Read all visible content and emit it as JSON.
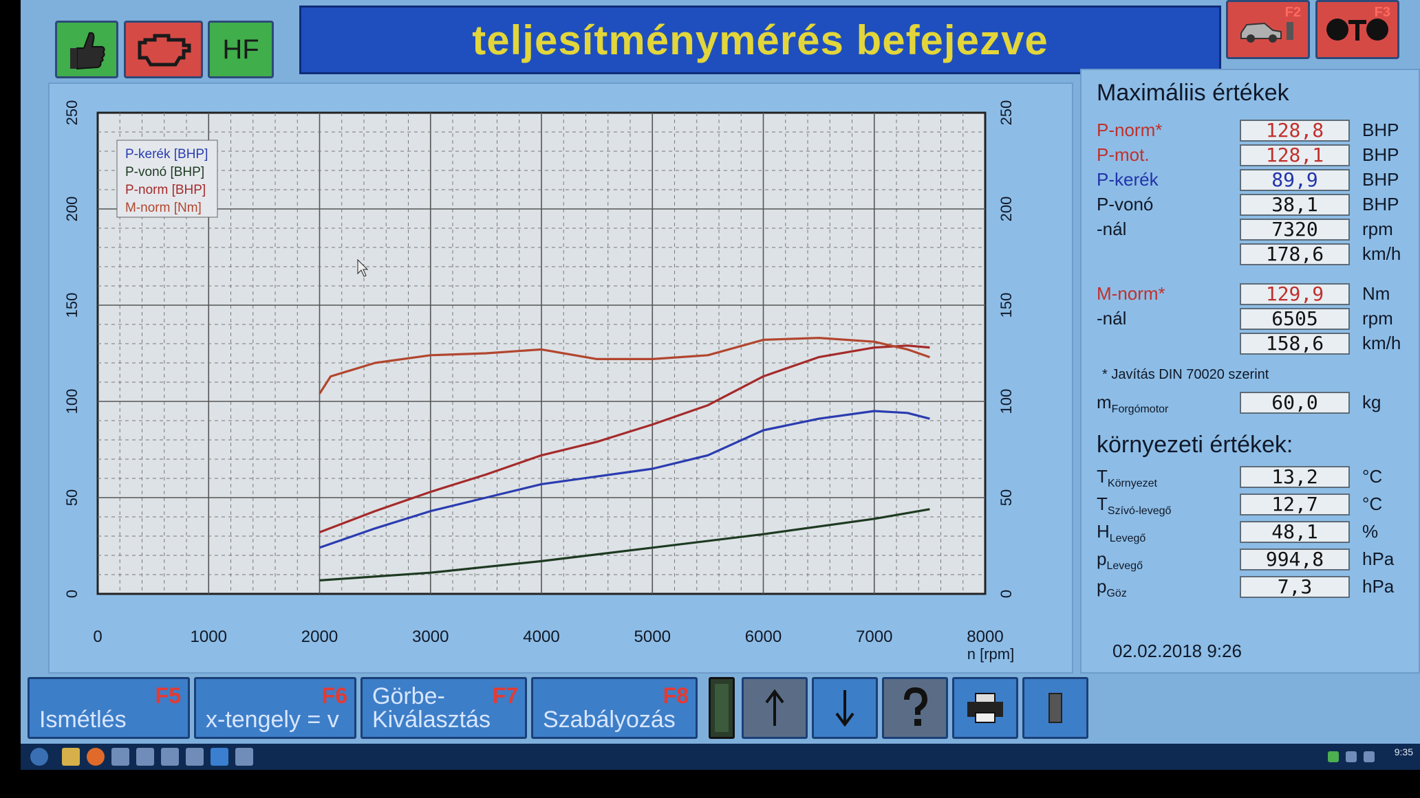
{
  "header": {
    "title": "teljesítménymérés befejezve",
    "hf_label": "HF",
    "f2_label": "F2",
    "f3_label": "F3"
  },
  "chart_data": {
    "type": "line",
    "xlabel": "n [rpm]",
    "xlim": [
      0,
      8000
    ],
    "ylim": [
      0,
      250
    ],
    "xticks": [
      0,
      1000,
      2000,
      3000,
      4000,
      5000,
      6000,
      7000,
      8000
    ],
    "yticks": [
      0,
      50,
      100,
      150,
      200,
      250
    ],
    "grid": true,
    "legend_position": "top-left",
    "series": [
      {
        "name": "P-kerék [BHP]",
        "color": "#2a3cb0",
        "x": [
          2000,
          2500,
          3000,
          3500,
          4000,
          4500,
          5000,
          5500,
          6000,
          6500,
          7000,
          7300,
          7500
        ],
        "y": [
          24,
          34,
          43,
          50,
          57,
          61,
          65,
          72,
          85,
          91,
          95,
          94,
          91
        ]
      },
      {
        "name": "P-vonó [BHP]",
        "color": "#1e3a22",
        "x": [
          2000,
          3000,
          4000,
          5000,
          6000,
          7000,
          7500
        ],
        "y": [
          7,
          11,
          17,
          24,
          31,
          39,
          44
        ]
      },
      {
        "name": "P-norm [BHP]",
        "color": "#a52a2a",
        "x": [
          2000,
          2500,
          3000,
          3500,
          4000,
          4500,
          5000,
          5500,
          6000,
          6500,
          7000,
          7300,
          7500
        ],
        "y": [
          32,
          43,
          53,
          62,
          72,
          79,
          88,
          98,
          113,
          123,
          128,
          129,
          128
        ]
      },
      {
        "name": "M-norm [Nm]",
        "color": "#b2462e",
        "x": [
          2000,
          2100,
          2500,
          3000,
          3500,
          4000,
          4500,
          5000,
          5500,
          6000,
          6500,
          7000,
          7300,
          7500
        ],
        "y": [
          104,
          113,
          120,
          124,
          125,
          127,
          122,
          122,
          124,
          132,
          133,
          131,
          127,
          123
        ]
      }
    ]
  },
  "max_values": {
    "title": "Maximáliis értékek",
    "rows": [
      {
        "label": "P-norm*",
        "value": "128,8",
        "unit": "BHP"
      },
      {
        "label": "P-mot.",
        "value": "128,1",
        "unit": "BHP"
      },
      {
        "label": "P-kerék",
        "value": "89,9",
        "unit": "BHP"
      },
      {
        "label": "P-vonó",
        "value": "38,1",
        "unit": "BHP"
      },
      {
        "label": "-nál",
        "value": "7320",
        "unit": "rpm"
      },
      {
        "label": "",
        "value": "178,6",
        "unit": "km/h"
      }
    ],
    "torque_rows": [
      {
        "label": "M-norm*",
        "value": "129,9",
        "unit": "Nm"
      },
      {
        "label": "-nál",
        "value": "6505",
        "unit": "rpm"
      },
      {
        "label": "",
        "value": "158,6",
        "unit": "km/h"
      }
    ],
    "note": "* Javítás DIN 70020 szerint",
    "mass": {
      "label": "m",
      "sub": "Forgómotor",
      "value": "60,0",
      "unit": "kg"
    }
  },
  "env": {
    "title": "környezeti értékek:",
    "rows": [
      {
        "label": "T",
        "sub": "Környezet",
        "value": "13,2",
        "unit": "°C"
      },
      {
        "label": "T",
        "sub": "Szívó-levegő",
        "value": "12,7",
        "unit": "°C"
      },
      {
        "label": "H",
        "sub": "Levegő",
        "value": "48,1",
        "unit": "%"
      },
      {
        "label": "p",
        "sub": "Levegő",
        "value": "994,8",
        "unit": "hPa"
      },
      {
        "label": "p",
        "sub": "Göz",
        "value": "7,3",
        "unit": "hPa"
      }
    ],
    "date": "02.02.2018  9:26"
  },
  "toolbar": {
    "f5": {
      "label": "Ismétlés",
      "key": "F5"
    },
    "f6": {
      "label": "x-tengely = v",
      "key": "F6"
    },
    "f7": {
      "label1": "Görbe-",
      "label2": "Kiválasztás",
      "key": "F7"
    },
    "f8": {
      "label": "Szabályozás",
      "key": "F8"
    }
  },
  "taskbar": {
    "clock": "9:35"
  }
}
